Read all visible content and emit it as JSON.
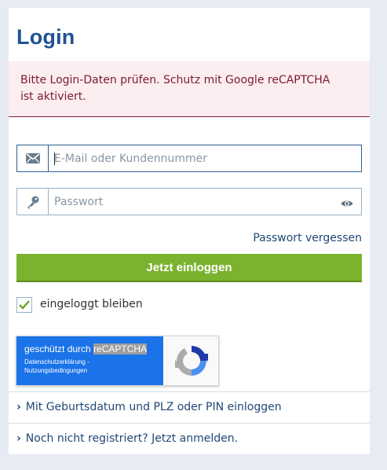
{
  "title": "Login",
  "alert": {
    "message": "Bitte Login-Daten prüfen. Schutz mit Google reCAPTCHA ist aktiviert."
  },
  "email_field": {
    "placeholder": "E-Mail oder Kundennummer",
    "value": "",
    "icon": "envelope-icon"
  },
  "password_field": {
    "placeholder": "Passwort",
    "value": "",
    "icon": "key-icon",
    "toggle_icon": "eye-icon"
  },
  "forgot_link": "Passwort vergessen",
  "login_button": "Jetzt einloggen",
  "remember": {
    "label": "eingeloggt bleiben",
    "checked": true
  },
  "recaptcha": {
    "prefix": "geschützt durch ",
    "brand": "reCAPTCHA",
    "links": "Datenschutzerklärung -\nNutzungsbedingungen"
  },
  "alt_links": [
    {
      "label": "Mit Geburtsdatum und PLZ oder PIN einloggen"
    },
    {
      "label": "Noch nicht registriert? Jetzt anmelden."
    }
  ],
  "colors": {
    "brand": "#1f5293",
    "accent_green": "#7bb22e",
    "alert_bg": "#fcedf0",
    "alert_text": "#7a1a2f",
    "page_bg": "#e6ebf4"
  }
}
